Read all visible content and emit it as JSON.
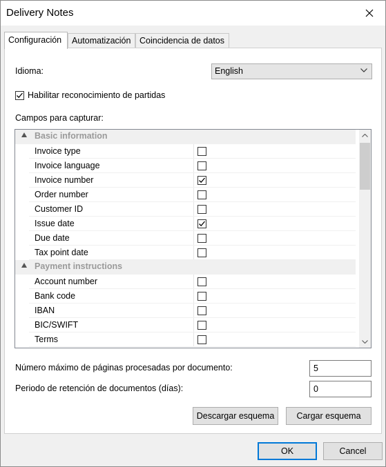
{
  "window": {
    "title": "Delivery Notes"
  },
  "tabs": [
    {
      "label": "Configuración",
      "active": true
    },
    {
      "label": "Automatización",
      "active": false
    },
    {
      "label": "Coincidencia de datos",
      "active": false
    }
  ],
  "config": {
    "language_label": "Idioma:",
    "language_value": "English",
    "line_items_label": "Habilitar reconocimiento de partidas",
    "line_items_checked": true,
    "fields_label": "Campos para capturar:",
    "groups": [
      {
        "name": "Basic information",
        "fields": [
          {
            "label": "Invoice type",
            "checked": false
          },
          {
            "label": "Invoice language",
            "checked": false
          },
          {
            "label": "Invoice number",
            "checked": true
          },
          {
            "label": "Order number",
            "checked": false
          },
          {
            "label": "Customer ID",
            "checked": false
          },
          {
            "label": "Issue date",
            "checked": true
          },
          {
            "label": "Due date",
            "checked": false
          },
          {
            "label": "Tax point date",
            "checked": false
          }
        ]
      },
      {
        "name": "Payment instructions",
        "fields": [
          {
            "label": "Account number",
            "checked": false
          },
          {
            "label": "Bank code",
            "checked": false
          },
          {
            "label": "IBAN",
            "checked": false
          },
          {
            "label": "BIC/SWIFT",
            "checked": false
          },
          {
            "label": "Terms",
            "checked": false
          }
        ]
      }
    ],
    "max_pages_label": "Número máximo de páginas procesadas por documento:",
    "max_pages_value": "5",
    "retention_label": "Periodo de retención de documentos (días):",
    "retention_value": "0",
    "download_schema": "Descargar esquema",
    "upload_schema": "Cargar esquema"
  },
  "footer": {
    "ok": "OK",
    "cancel": "Cancel"
  }
}
